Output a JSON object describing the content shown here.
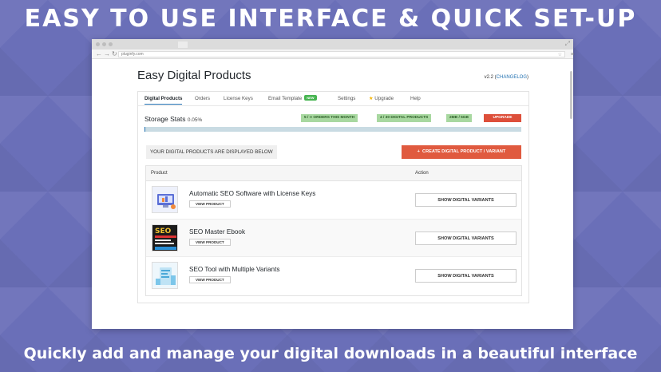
{
  "headline": "EASY TO USE INTERFACE & QUICK SET-UP",
  "tagline": "Quickly add and manage your digital downloads in a beautiful interface",
  "browser": {
    "url": "pluginfy.com",
    "star_icon": "star-icon",
    "menu_icon": "menu-icon"
  },
  "app": {
    "title": "Easy Digital Products",
    "version": "v2.2",
    "changelog_label": "CHANGELOG",
    "tabs": [
      {
        "label": "Digital Products"
      },
      {
        "label": "Orders"
      },
      {
        "label": "License Keys"
      },
      {
        "label": "Email Template"
      },
      {
        "label": "Settings"
      },
      {
        "label": "Upgrade"
      },
      {
        "label": "Help"
      }
    ],
    "new_badge": "NEW",
    "storage": {
      "label": "Storage Stats",
      "percent": "0.05%",
      "fill_fraction": 0.0005,
      "badges": [
        "5 / ∞ ORDERS THIS MONTH",
        "4 / 30 DIGITAL PRODUCTS",
        "2MB / 5GB"
      ],
      "upgrade_label": "UPGRADE"
    },
    "displayed_label": "YOUR DIGITAL PRODUCTS ARE DISPLAYED BELOW",
    "create_label": "CREATE DIGITAL PRODUCT / VARIANT",
    "table": {
      "col_product": "Product",
      "col_action": "Action",
      "view_label": "VIEW PRODUCT",
      "variants_label": "SHOW DIGITAL VARIANTS",
      "rows": [
        {
          "name": "Automatic SEO Software with License Keys",
          "thumb": "seo-software-icon"
        },
        {
          "name": "SEO Master Ebook",
          "thumb": "seo-ebook-cover"
        },
        {
          "name": "SEO Tool with Multiple Variants",
          "thumb": "seo-tool-icon"
        }
      ]
    }
  },
  "colors": {
    "background": "#6a6fb8",
    "accent_blue": "#2271b1",
    "create_button": "#e05a3f",
    "upgrade_button": "#dd4f3a",
    "badge_green": "#a8d8a0"
  }
}
